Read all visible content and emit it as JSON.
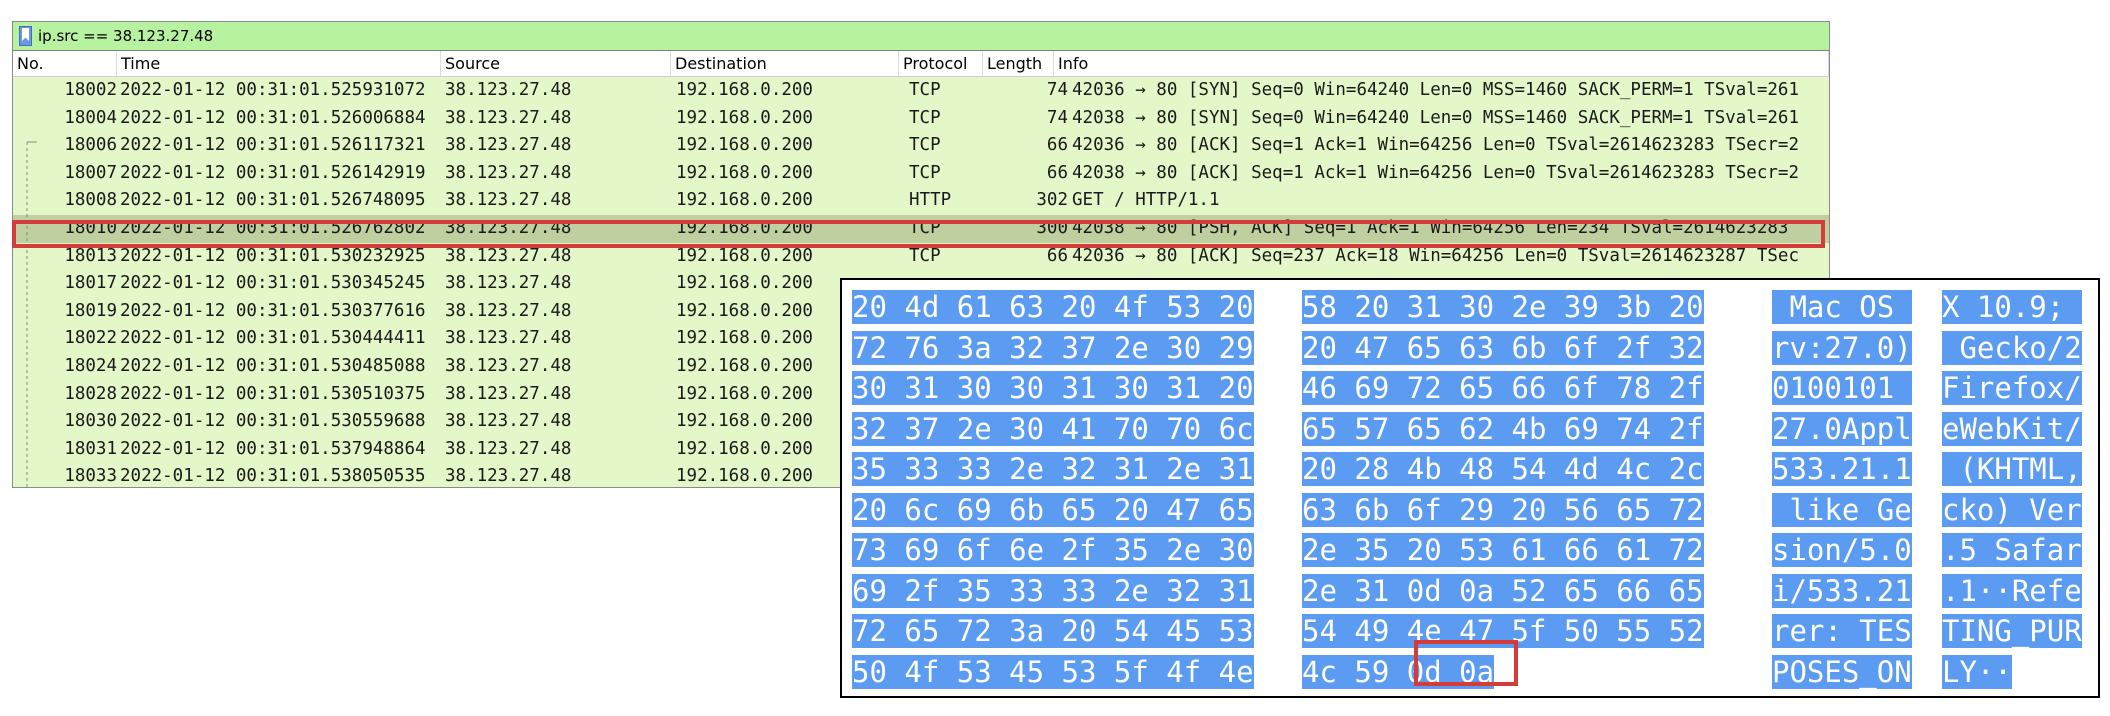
{
  "filter": {
    "text": "ip.src == 38.123.27.48"
  },
  "columns": [
    "No.",
    "Time",
    "Source",
    "Destination",
    "Protocol",
    "Length",
    "Info"
  ],
  "packets": [
    {
      "no": "18002",
      "time": "2022-01-12 00:31:01.525931072",
      "src": "38.123.27.48",
      "dst": "192.168.0.200",
      "proto": "TCP",
      "len": "74",
      "info": "42036 → 80 [SYN] Seq=0 Win=64240 Len=0 MSS=1460 SACK_PERM=1 TSval=261"
    },
    {
      "no": "18004",
      "time": "2022-01-12 00:31:01.526006884",
      "src": "38.123.27.48",
      "dst": "192.168.0.200",
      "proto": "TCP",
      "len": "74",
      "info": "42038 → 80 [SYN] Seq=0 Win=64240 Len=0 MSS=1460 SACK_PERM=1 TSval=261"
    },
    {
      "no": "18006",
      "time": "2022-01-12 00:31:01.526117321",
      "src": "38.123.27.48",
      "dst": "192.168.0.200",
      "proto": "TCP",
      "len": "66",
      "info": "42036 → 80 [ACK] Seq=1 Ack=1 Win=64256 Len=0 TSval=2614623283 TSecr=2"
    },
    {
      "no": "18007",
      "time": "2022-01-12 00:31:01.526142919",
      "src": "38.123.27.48",
      "dst": "192.168.0.200",
      "proto": "TCP",
      "len": "66",
      "info": "42038 → 80 [ACK] Seq=1 Ack=1 Win=64256 Len=0 TSval=2614623283 TSecr=2"
    },
    {
      "no": "18008",
      "time": "2022-01-12 00:31:01.526748095",
      "src": "38.123.27.48",
      "dst": "192.168.0.200",
      "proto": "HTTP",
      "len": "302",
      "info": "GET / HTTP/1.1"
    },
    {
      "no": "18010",
      "time": "2022-01-12 00:31:01.526762802",
      "src": "38.123.27.48",
      "dst": "192.168.0.200",
      "proto": "TCP",
      "len": "300",
      "info": "42038 → 80 [PSH, ACK] Seq=1 Ack=1 Win=64256 Len=234 TSval=2614623283"
    },
    {
      "no": "18013",
      "time": "2022-01-12 00:31:01.530232925",
      "src": "38.123.27.48",
      "dst": "192.168.0.200",
      "proto": "TCP",
      "len": "66",
      "info": "42036 → 80 [ACK] Seq=237 Ack=18 Win=64256 Len=0 TSval=2614623287 TSec"
    },
    {
      "no": "18017",
      "time": "2022-01-12 00:31:01.530345245",
      "src": "38.123.27.48",
      "dst": "192.168.0.200",
      "proto": "",
      "len": "",
      "info": ""
    },
    {
      "no": "18019",
      "time": "2022-01-12 00:31:01.530377616",
      "src": "38.123.27.48",
      "dst": "192.168.0.200",
      "proto": "",
      "len": "",
      "info": ""
    },
    {
      "no": "18022",
      "time": "2022-01-12 00:31:01.530444411",
      "src": "38.123.27.48",
      "dst": "192.168.0.200",
      "proto": "",
      "len": "",
      "info": ""
    },
    {
      "no": "18024",
      "time": "2022-01-12 00:31:01.530485088",
      "src": "38.123.27.48",
      "dst": "192.168.0.200",
      "proto": "",
      "len": "",
      "info": ""
    },
    {
      "no": "18028",
      "time": "2022-01-12 00:31:01.530510375",
      "src": "38.123.27.48",
      "dst": "192.168.0.200",
      "proto": "",
      "len": "",
      "info": ""
    },
    {
      "no": "18030",
      "time": "2022-01-12 00:31:01.530559688",
      "src": "38.123.27.48",
      "dst": "192.168.0.200",
      "proto": "",
      "len": "",
      "info": ""
    },
    {
      "no": "18031",
      "time": "2022-01-12 00:31:01.537948864",
      "src": "38.123.27.48",
      "dst": "192.168.0.200",
      "proto": "",
      "len": "",
      "info": ""
    },
    {
      "no": "18033",
      "time": "2022-01-12 00:31:01.538050535",
      "src": "38.123.27.48",
      "dst": "192.168.0.200",
      "proto": "",
      "len": "",
      "info": ""
    }
  ],
  "selected_packet": "18010",
  "hex_dump": [
    {
      "hex_left": "20 4d 61 63 20 4f 53 20",
      "hex_right": "58 20 31 30 2e 39 3b 20",
      "ascii_left": " Mac OS ",
      "ascii_right": "X 10.9; "
    },
    {
      "hex_left": "72 76 3a 32 37 2e 30 29",
      "hex_right": "20 47 65 63 6b 6f 2f 32",
      "ascii_left": "rv:27.0)",
      "ascii_right": " Gecko/2"
    },
    {
      "hex_left": "30 31 30 30 31 30 31 20",
      "hex_right": "46 69 72 65 66 6f 78 2f",
      "ascii_left": "0100101 ",
      "ascii_right": "Firefox/"
    },
    {
      "hex_left": "32 37 2e 30 41 70 70 6c",
      "hex_right": "65 57 65 62 4b 69 74 2f",
      "ascii_left": "27.0Appl",
      "ascii_right": "eWebKit/"
    },
    {
      "hex_left": "35 33 33 2e 32 31 2e 31",
      "hex_right": "20 28 4b 48 54 4d 4c 2c",
      "ascii_left": "533.21.1",
      "ascii_right": " (KHTML,"
    },
    {
      "hex_left": "20 6c 69 6b 65 20 47 65",
      "hex_right": "63 6b 6f 29 20 56 65 72",
      "ascii_left": " like Ge",
      "ascii_right": "cko) Ver"
    },
    {
      "hex_left": "73 69 6f 6e 2f 35 2e 30",
      "hex_right": "2e 35 20 53 61 66 61 72",
      "ascii_left": "sion/5.0",
      "ascii_right": ".5 Safar"
    },
    {
      "hex_left": "69 2f 35 33 33 2e 32 31",
      "hex_right": "2e 31 0d 0a 52 65 66 65",
      "ascii_left": "i/533.21",
      "ascii_right": ".1··Refe"
    },
    {
      "hex_left": "72 65 72 3a 20 54 45 53",
      "hex_right": "54 49 4e 47 5f 50 55 52",
      "ascii_left": "rer: TES",
      "ascii_right": "TING_PUR"
    },
    {
      "hex_left": "50 4f 53 45 53 5f 4f 4e",
      "hex_right": "4c 59 0d 0a",
      "ascii_left": "POSES_ON",
      "ascii_right": "LY··"
    }
  ],
  "colors": {
    "row_bg": "#e4f7c8",
    "selected_row_bg": "#c0cf9f",
    "filter_bg": "#b7f2a0",
    "hex_selection": "#5b9cf2",
    "highlight_border": "#d43c3c"
  }
}
